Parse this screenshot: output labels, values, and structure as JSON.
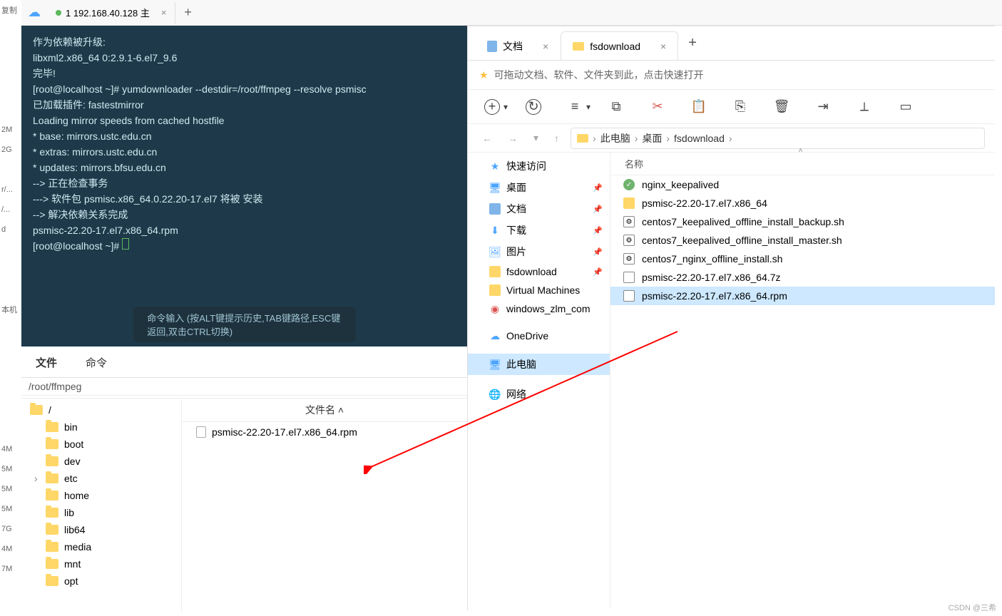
{
  "left_strip": [
    "复制",
    "",
    "",
    "",
    "",
    "",
    "2M",
    "2G",
    "",
    "r/...",
    "/...",
    "d",
    "",
    "",
    "",
    "本机",
    "",
    "",
    "",
    "",
    "",
    "",
    "4M",
    "5M",
    "5M",
    "5M",
    "7G",
    "4M",
    "7M"
  ],
  "app_tabs": {
    "tab1": "1 192.168.40.128 主"
  },
  "terminal": {
    "lines": [
      "作为依赖被升级:",
      "  libxml2.x86_64 0:2.9.1-6.el7_9.6",
      "",
      "完毕!",
      "[root@localhost ~]# yumdownloader --destdir=/root/ffmpeg --resolve psmisc",
      "已加载插件: fastestmirror",
      "Loading mirror speeds from cached hostfile",
      " * base: mirrors.ustc.edu.cn",
      " * extras: mirrors.ustc.edu.cn",
      " * updates: mirrors.bfsu.edu.cn",
      "--> 正在检查事务",
      "---> 软件包 psmisc.x86_64.0.22.20-17.el7 将被 安装",
      "--> 解决依赖关系完成",
      "psmisc-22.20-17.el7.x86_64.rpm",
      "[root@localhost ~]# "
    ],
    "hint": "命令输入 (按ALT键提示历史,TAB键路径,ESC键返回,双击CTRL切换)"
  },
  "bottom": {
    "tab_file": "文件",
    "tab_cmd": "命令",
    "path": "/root/ffmpeg",
    "tree": [
      "/",
      "bin",
      "boot",
      "dev",
      "etc",
      "home",
      "lib",
      "lib64",
      "media",
      "mnt",
      "opt"
    ],
    "list_header": "文件名 ˄",
    "list_items": [
      "psmisc-22.20-17.el7.x86_64.rpm"
    ]
  },
  "explorer": {
    "tab1": "文档",
    "tab2": "fsdownload",
    "drop_hint": "可拖动文档、软件、文件夹到此，点击快速打开",
    "breadcrumb": [
      "此电脑",
      "桌面",
      "fsdownload"
    ],
    "side_quick": "快速访问",
    "side_items": {
      "desktop": "桌面",
      "docs": "文档",
      "downloads": "下载",
      "pictures": "图片",
      "fsdl": "fsdownload",
      "vm": "Virtual Machines",
      "zlm": "windows_zlm_com"
    },
    "side_onedrive": "OneDrive",
    "side_thispc": "此电脑",
    "side_network": "网络",
    "col_name": "名称",
    "files": {
      "f1": "nginx_keepalived",
      "f2": "psmisc-22.20-17.el7.x86_64",
      "f3": "centos7_keepalived_offline_install_backup.sh",
      "f4": "centos7_keepalived_offline_install_master.sh",
      "f5": "centos7_nginx_offline_install.sh",
      "f6": "psmisc-22.20-17.el7.x86_64.7z",
      "f7": "psmisc-22.20-17.el7.x86_64.rpm"
    }
  },
  "watermark": "CSDN @三希"
}
